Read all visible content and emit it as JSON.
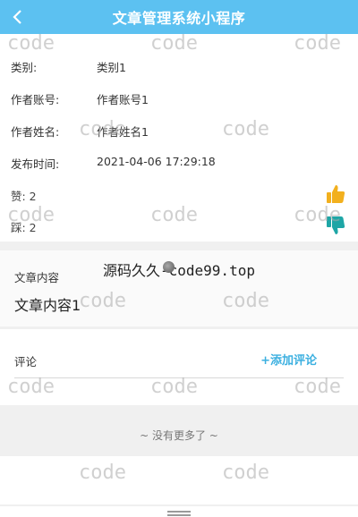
{
  "navbar": {
    "title": "文章管理系统小程序",
    "back_icon": "chevron-left-icon"
  },
  "info": {
    "rows": [
      {
        "label": "类别:",
        "value": "类别1"
      },
      {
        "label": "作者账号:",
        "value": "作者账号1"
      },
      {
        "label": "作者姓名:",
        "value": "作者姓名1"
      },
      {
        "label": "发布时间:",
        "value": "2021-04-06 17:29:18"
      }
    ],
    "likes": "赞: 2",
    "dislikes": "踩: 2",
    "like_icon": "thumbs-up-icon",
    "dislike_icon": "thumbs-down-icon"
  },
  "content": {
    "label": "文章内容",
    "text": "文章内容1"
  },
  "comments": {
    "title": "评论",
    "add_label": "+添加评论"
  },
  "list_end": "~ 没有更多了 ~",
  "overlay": {
    "watermark": "code",
    "banner": "源码久久-code99.top"
  },
  "colors": {
    "navbar": "#5cc1f1",
    "accent": "#3cb0e0",
    "like": "#f2b01e",
    "dislike": "#1ea6a6"
  }
}
